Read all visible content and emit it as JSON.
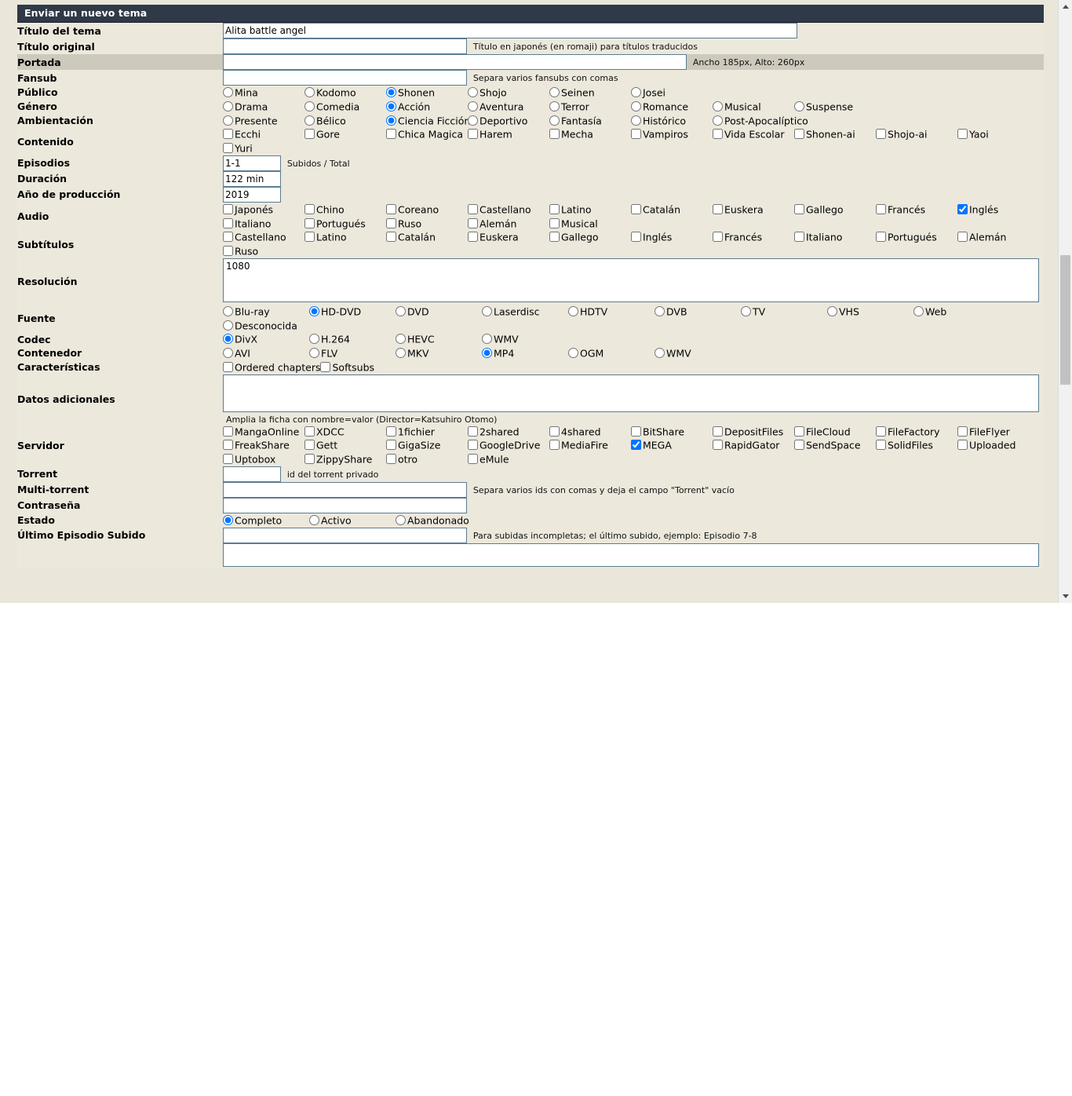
{
  "form": {
    "title": "Enviar un nuevo tema",
    "labels": {
      "titulo_tema": "Título del tema",
      "titulo_original": "Título original",
      "portada": "Portada",
      "fansub": "Fansub",
      "publico": "Público",
      "genero": "Género",
      "ambientacion": "Ambientación",
      "contenido": "Contenido",
      "episodios": "Episodios",
      "duracion": "Duración",
      "anio": "Año de producción",
      "audio": "Audio",
      "subtitulos": "Subtítulos",
      "resolucion": "Resolución",
      "fuente": "Fuente",
      "codec": "Codec",
      "contenedor": "Contenedor",
      "caracteristicas": "Características",
      "datos_adicionales": "Datos adicionales",
      "servidor": "Servidor",
      "torrent": "Torrent",
      "multi_torrent": "Multi-torrent",
      "contrasena": "Contraseña",
      "estado": "Estado",
      "ultimo_episodio": "Último Episodio Subido"
    },
    "values": {
      "titulo_tema": "Alita battle angel",
      "titulo_original": "",
      "portada": "",
      "fansub": "",
      "episodios": "1-1",
      "duracion": "122 min",
      "anio": "2019",
      "resolucion": "1080",
      "datos_adicionales": "",
      "torrent": "",
      "multi_torrent": "",
      "contrasena": "",
      "ultimo_episodio": "",
      "bottom_textarea": ""
    },
    "hints": {
      "titulo_original": "Título en japonés (en romaji) para títulos traducidos",
      "portada": "Ancho 185px, Alto: 260px",
      "fansub": "Separa varios fansubs con comas",
      "episodios": "Subidos / Total",
      "datos_adicionales": "Amplia la ficha con nombre=valor (Director=Katsuhiro Otomo)",
      "torrent": "id del torrent privado",
      "multi_torrent": "Separa varios ids con comas y deja el campo \"Torrent\" vacío",
      "ultimo_episodio": "Para subidas incompletas; el último subido, ejemplo: Episodio 7-8"
    },
    "publico": [
      {
        "label": "Mina",
        "checked": false
      },
      {
        "label": "Kodomo",
        "checked": false
      },
      {
        "label": "Shonen",
        "checked": true
      },
      {
        "label": "Shojo",
        "checked": false
      },
      {
        "label": "Seinen",
        "checked": false
      },
      {
        "label": "Josei",
        "checked": false
      }
    ],
    "genero": [
      {
        "label": "Drama",
        "checked": false
      },
      {
        "label": "Comedia",
        "checked": false
      },
      {
        "label": "Acción",
        "checked": true
      },
      {
        "label": "Aventura",
        "checked": false
      },
      {
        "label": "Terror",
        "checked": false
      },
      {
        "label": "Romance",
        "checked": false
      },
      {
        "label": "Musical",
        "checked": false
      },
      {
        "label": "Suspense",
        "checked": false
      }
    ],
    "ambientacion": [
      {
        "label": "Presente",
        "checked": false
      },
      {
        "label": "Bélico",
        "checked": false
      },
      {
        "label": "Ciencia Ficción",
        "checked": true
      },
      {
        "label": "Deportivo",
        "checked": false
      },
      {
        "label": "Fantasía",
        "checked": false
      },
      {
        "label": "Histórico",
        "checked": false
      },
      {
        "label": "Post-Apocalíptico",
        "checked": false
      }
    ],
    "contenido": [
      {
        "label": "Ecchi",
        "checked": false
      },
      {
        "label": "Gore",
        "checked": false
      },
      {
        "label": "Chica Magica",
        "checked": false
      },
      {
        "label": "Harem",
        "checked": false
      },
      {
        "label": "Mecha",
        "checked": false
      },
      {
        "label": "Vampiros",
        "checked": false
      },
      {
        "label": "Vida Escolar",
        "checked": false
      },
      {
        "label": "Shonen-ai",
        "checked": false
      },
      {
        "label": "Shojo-ai",
        "checked": false
      },
      {
        "label": "Yaoi",
        "checked": false
      },
      {
        "label": "Yuri",
        "checked": false
      }
    ],
    "audio": [
      {
        "label": "Japonés",
        "checked": false
      },
      {
        "label": "Chino",
        "checked": false
      },
      {
        "label": "Coreano",
        "checked": false
      },
      {
        "label": "Castellano",
        "checked": false
      },
      {
        "label": "Latino",
        "checked": false
      },
      {
        "label": "Catalán",
        "checked": false
      },
      {
        "label": "Euskera",
        "checked": false
      },
      {
        "label": "Gallego",
        "checked": false
      },
      {
        "label": "Francés",
        "checked": false
      },
      {
        "label": "Inglés",
        "checked": true
      },
      {
        "label": "Italiano",
        "checked": false
      },
      {
        "label": "Portugués",
        "checked": false
      },
      {
        "label": "Ruso",
        "checked": false
      },
      {
        "label": "Alemán",
        "checked": false
      },
      {
        "label": "Musical",
        "checked": false
      }
    ],
    "subtitulos": [
      {
        "label": "Castellano",
        "checked": false
      },
      {
        "label": "Latino",
        "checked": false
      },
      {
        "label": "Catalán",
        "checked": false
      },
      {
        "label": "Euskera",
        "checked": false
      },
      {
        "label": "Gallego",
        "checked": false
      },
      {
        "label": "Inglés",
        "checked": false
      },
      {
        "label": "Francés",
        "checked": false
      },
      {
        "label": "Italiano",
        "checked": false
      },
      {
        "label": "Portugués",
        "checked": false
      },
      {
        "label": "Alemán",
        "checked": false
      },
      {
        "label": "Ruso",
        "checked": false
      }
    ],
    "fuente": [
      {
        "label": "Blu-ray",
        "checked": false
      },
      {
        "label": "HD-DVD",
        "checked": true
      },
      {
        "label": "DVD",
        "checked": false
      },
      {
        "label": "Laserdisc",
        "checked": false
      },
      {
        "label": "HDTV",
        "checked": false
      },
      {
        "label": "DVB",
        "checked": false
      },
      {
        "label": "TV",
        "checked": false
      },
      {
        "label": "VHS",
        "checked": false
      },
      {
        "label": "Web",
        "checked": false
      },
      {
        "label": "Desconocida",
        "checked": false
      }
    ],
    "codec": [
      {
        "label": "DivX",
        "checked": true
      },
      {
        "label": "H.264",
        "checked": false
      },
      {
        "label": "HEVC",
        "checked": false
      },
      {
        "label": "WMV",
        "checked": false
      }
    ],
    "contenedor": [
      {
        "label": "AVI",
        "checked": false
      },
      {
        "label": "FLV",
        "checked": false
      },
      {
        "label": "MKV",
        "checked": false
      },
      {
        "label": "MP4",
        "checked": true
      },
      {
        "label": "OGM",
        "checked": false
      },
      {
        "label": "WMV",
        "checked": false
      }
    ],
    "caracteristicas": [
      {
        "label": "Ordered chapters",
        "checked": false
      },
      {
        "label": "Softsubs",
        "checked": false
      }
    ],
    "servidor": [
      {
        "label": "MangaOnline",
        "checked": false
      },
      {
        "label": "XDCC",
        "checked": false
      },
      {
        "label": "1fichier",
        "checked": false
      },
      {
        "label": "2shared",
        "checked": false
      },
      {
        "label": "4shared",
        "checked": false
      },
      {
        "label": "BitShare",
        "checked": false
      },
      {
        "label": "DepositFiles",
        "checked": false
      },
      {
        "label": "FileCloud",
        "checked": false
      },
      {
        "label": "FileFactory",
        "checked": false
      },
      {
        "label": "FileFlyer",
        "checked": false
      },
      {
        "label": "FreakShare",
        "checked": false
      },
      {
        "label": "Gett",
        "checked": false
      },
      {
        "label": "GigaSize",
        "checked": false
      },
      {
        "label": "GoogleDrive",
        "checked": false
      },
      {
        "label": "MediaFire",
        "checked": false
      },
      {
        "label": "MEGA",
        "checked": true
      },
      {
        "label": "RapidGator",
        "checked": false
      },
      {
        "label": "SendSpace",
        "checked": false
      },
      {
        "label": "SolidFiles",
        "checked": false
      },
      {
        "label": "Uploaded",
        "checked": false
      },
      {
        "label": "Uptobox",
        "checked": false
      },
      {
        "label": "ZippyShare",
        "checked": false
      },
      {
        "label": "otro",
        "checked": false
      },
      {
        "label": "eMule",
        "checked": false
      }
    ],
    "estado": [
      {
        "label": "Completo",
        "checked": true
      },
      {
        "label": "Activo",
        "checked": false
      },
      {
        "label": "Abandonado",
        "checked": false
      }
    ]
  },
  "scrollbar": {
    "up_arrow": "scroll-up-icon",
    "down_arrow": "scroll-down-icon"
  }
}
